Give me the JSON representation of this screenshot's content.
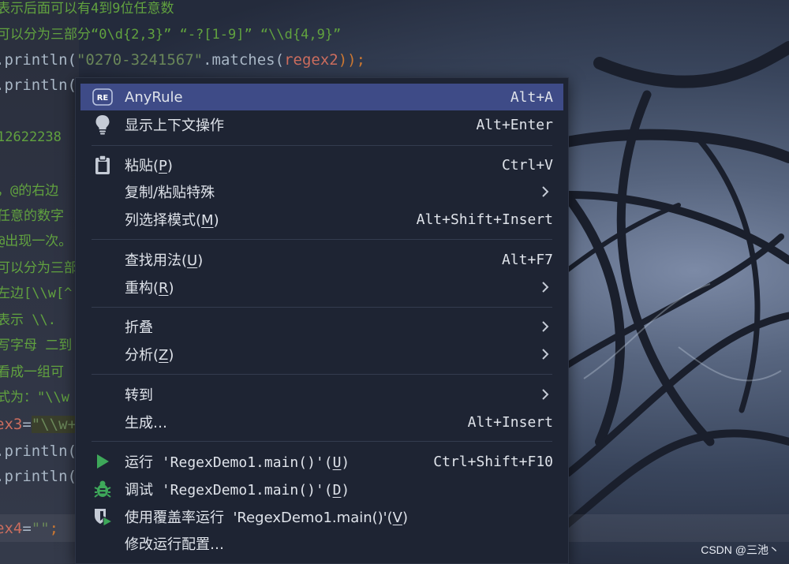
{
  "editor": {
    "comment_line_1": "表示后面可以有4到9位任意数",
    "comment_line_2": "可以分为三部分“0\\d{2,3}” “-?[1-9]” “\\\\d{4,9}”",
    "println_line_1": {
      "prefix": ".println(",
      "string": "\"0270-3241567\"",
      "mid": ".matches(",
      "var": "regex2",
      "suffix": "));"
    },
    "println_line_2": ".println(",
    "number_fragment": "12622238",
    "comment_line_3": "，@的右边",
    "comment_line_4": "任意的数字",
    "comment_line_5": "@出现一次。",
    "comment_line_6": "可以分为三部",
    "comment_line_7": "左边[\\\\w[^",
    "comment_line_8": "表示 \\\\.",
    "comment_line_9": "写字母 二到",
    "comment_line_10": "看成一组可",
    "comment_line_11": "式为：\"\\\\w",
    "regex3_line": {
      "var": "ex3",
      "eq": "=",
      "string": "\"\\\\w+"
    },
    "println_line_3": ".println(",
    "println_line_4": ".println(",
    "regex4_line": {
      "var": "ex4",
      "eq": "=",
      "string": "\"\"",
      "semi": ";"
    }
  },
  "watermark": "CSDN @三池丶",
  "menu": {
    "items": [
      {
        "label": "AnyRule",
        "shortcut": "Alt+A",
        "icon": "regex-plugin-icon"
      },
      {
        "label": "显示上下文操作",
        "shortcut": "Alt+Enter",
        "icon": "lightbulb-icon"
      },
      {
        "label_pre": "粘贴(",
        "mnemonic": "P",
        "label_post": ")",
        "shortcut": "Ctrl+V",
        "icon": "clipboard-icon"
      },
      {
        "label": "复制/粘贴特殊",
        "submenu": true
      },
      {
        "label_pre": "列选择模式(",
        "mnemonic": "M",
        "label_post": ")",
        "shortcut": "Alt+Shift+Insert"
      },
      {
        "label_pre": "查找用法(",
        "mnemonic": "U",
        "label_post": ")",
        "shortcut": "Alt+F7"
      },
      {
        "label_pre": "重构(",
        "mnemonic": "R",
        "label_post": ")",
        "submenu": true
      },
      {
        "label": "折叠",
        "submenu": true
      },
      {
        "label_pre": "分析(",
        "mnemonic": "Z",
        "label_post": ")",
        "submenu": true
      },
      {
        "label": "转到",
        "submenu": true
      },
      {
        "label": "生成…",
        "shortcut": "Alt+Insert"
      },
      {
        "label_pre": "运行 'RegexDemo1.main()'(",
        "mnemonic": "U",
        "label_post": ")",
        "shortcut": "Ctrl+Shift+F10",
        "icon": "run-icon"
      },
      {
        "label_pre": "调试 'RegexDemo1.main()'(",
        "mnemonic": "D",
        "label_post": ")",
        "icon": "debug-bug-icon"
      },
      {
        "label_pre": "使用覆盖率运行  'RegexDemo1.main()'(",
        "mnemonic": "V",
        "label_post": ")",
        "icon": "coverage-shield-icon"
      },
      {
        "label": "修改运行配置…"
      }
    ]
  },
  "colors": {
    "menu_bg": "#1e2433",
    "menu_selected": "#3e4b87",
    "run_green": "#3ea85a",
    "comment_green": "#61a23f",
    "string_green": "#6a8759",
    "variable": "#cc6d5e",
    "keyword": "#cc7832"
  }
}
